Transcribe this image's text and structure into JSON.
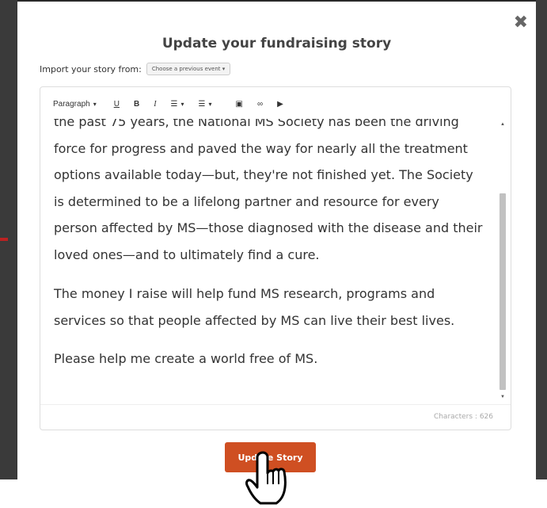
{
  "modal": {
    "title": "Update your fundraising story",
    "close_symbol": "✖"
  },
  "import": {
    "label": "Import your story from:",
    "select_value": "Choose a previous event ▾"
  },
  "toolbar": {
    "paragraph": "Paragraph",
    "paragraph_caret": "▾",
    "underline": "U",
    "bold": "B",
    "italic": "I",
    "ordered_list_icon": "☰",
    "ordered_caret": "▾",
    "bullet_list_icon": "☰",
    "bullet_caret": "▾",
    "image_icon": "▣",
    "link_icon": "∞",
    "video_icon": "▶"
  },
  "story": {
    "p1": "the past 75 years, the National MS Society has been the driving force for progress and paved the way for nearly all the treatment options available today—but, they're not finished yet. The Society is determined to be a lifelong partner and resource for every person affected by MS—those diagnosed with the disease and their loved ones—and to ultimately find a cure.",
    "p2": "The money I raise will help fund MS research, programs and services so that people affected by MS can live their best lives.",
    "p3": "Please help me create a world free of MS."
  },
  "character_count": "Characters : 626",
  "update_button": "Update Story"
}
